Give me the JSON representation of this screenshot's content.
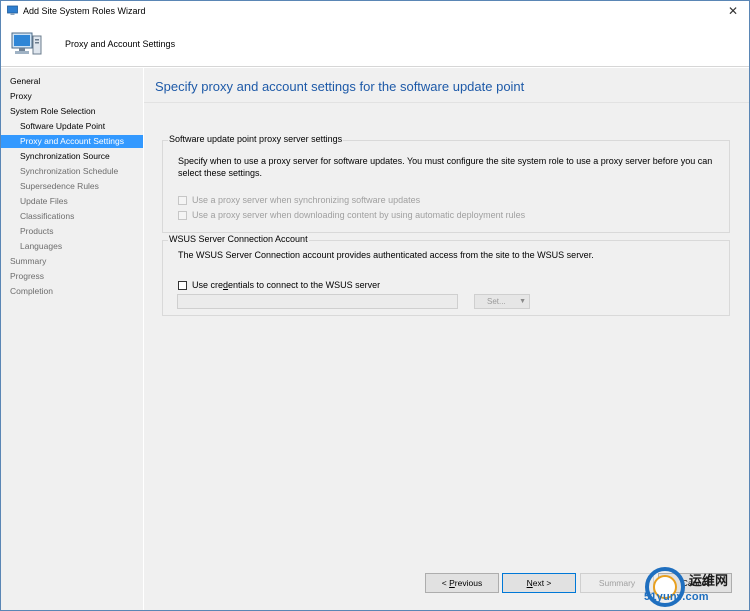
{
  "window": {
    "title": "Add Site System Roles Wizard",
    "close_glyph": "✕"
  },
  "header": {
    "title": "Proxy and Account Settings"
  },
  "sidebar": {
    "items": [
      {
        "label": "General",
        "level": 0,
        "state": "normal"
      },
      {
        "label": "Proxy",
        "level": 0,
        "state": "normal"
      },
      {
        "label": "System Role Selection",
        "level": 0,
        "state": "normal"
      },
      {
        "label": "Software Update Point",
        "level": 1,
        "state": "normal"
      },
      {
        "label": "Proxy and Account Settings",
        "level": 1,
        "state": "selected"
      },
      {
        "label": "Synchronization Source",
        "level": 1,
        "state": "normal"
      },
      {
        "label": "Synchronization Schedule",
        "level": 1,
        "state": "disabled"
      },
      {
        "label": "Supersedence Rules",
        "level": 1,
        "state": "disabled"
      },
      {
        "label": "Update Files",
        "level": 1,
        "state": "disabled"
      },
      {
        "label": "Classifications",
        "level": 1,
        "state": "disabled"
      },
      {
        "label": "Products",
        "level": 1,
        "state": "disabled"
      },
      {
        "label": "Languages",
        "level": 1,
        "state": "disabled"
      },
      {
        "label": "Summary",
        "level": 0,
        "state": "disabled"
      },
      {
        "label": "Progress",
        "level": 0,
        "state": "disabled"
      },
      {
        "label": "Completion",
        "level": 0,
        "state": "disabled"
      }
    ]
  },
  "main": {
    "heading": "Specify proxy and account settings for the software update point",
    "proxy_group": {
      "title": "Software update point proxy server settings",
      "description_line1": "Specify when to use a proxy server for software updates. You must configure the site system role to use a proxy server before you can",
      "description_line2": "select these settings.",
      "checkbox_sync": "Use a proxy server when synchronizing software updates",
      "checkbox_adr": "Use a proxy server when downloading content by using automatic deployment rules"
    },
    "wsus_group": {
      "title": "WSUS Server Connection Account",
      "description": "The WSUS Server Connection account provides authenticated access from the site to the WSUS server.",
      "checkbox_pre": "Use cre",
      "checkbox_accel": "d",
      "checkbox_post": "entials to connect to the WSUS server",
      "account_value": "",
      "set_label": "Set...",
      "set_arrow": "▼"
    }
  },
  "footer": {
    "previous_pre": "< ",
    "previous_accel": "P",
    "previous_post": "revious",
    "next_accel": "N",
    "next_post": "ext >",
    "summary_label": "Summary",
    "cancel_label": "Cancel"
  },
  "watermark": {
    "text": "运维网",
    "domain": "51yunv.com"
  }
}
